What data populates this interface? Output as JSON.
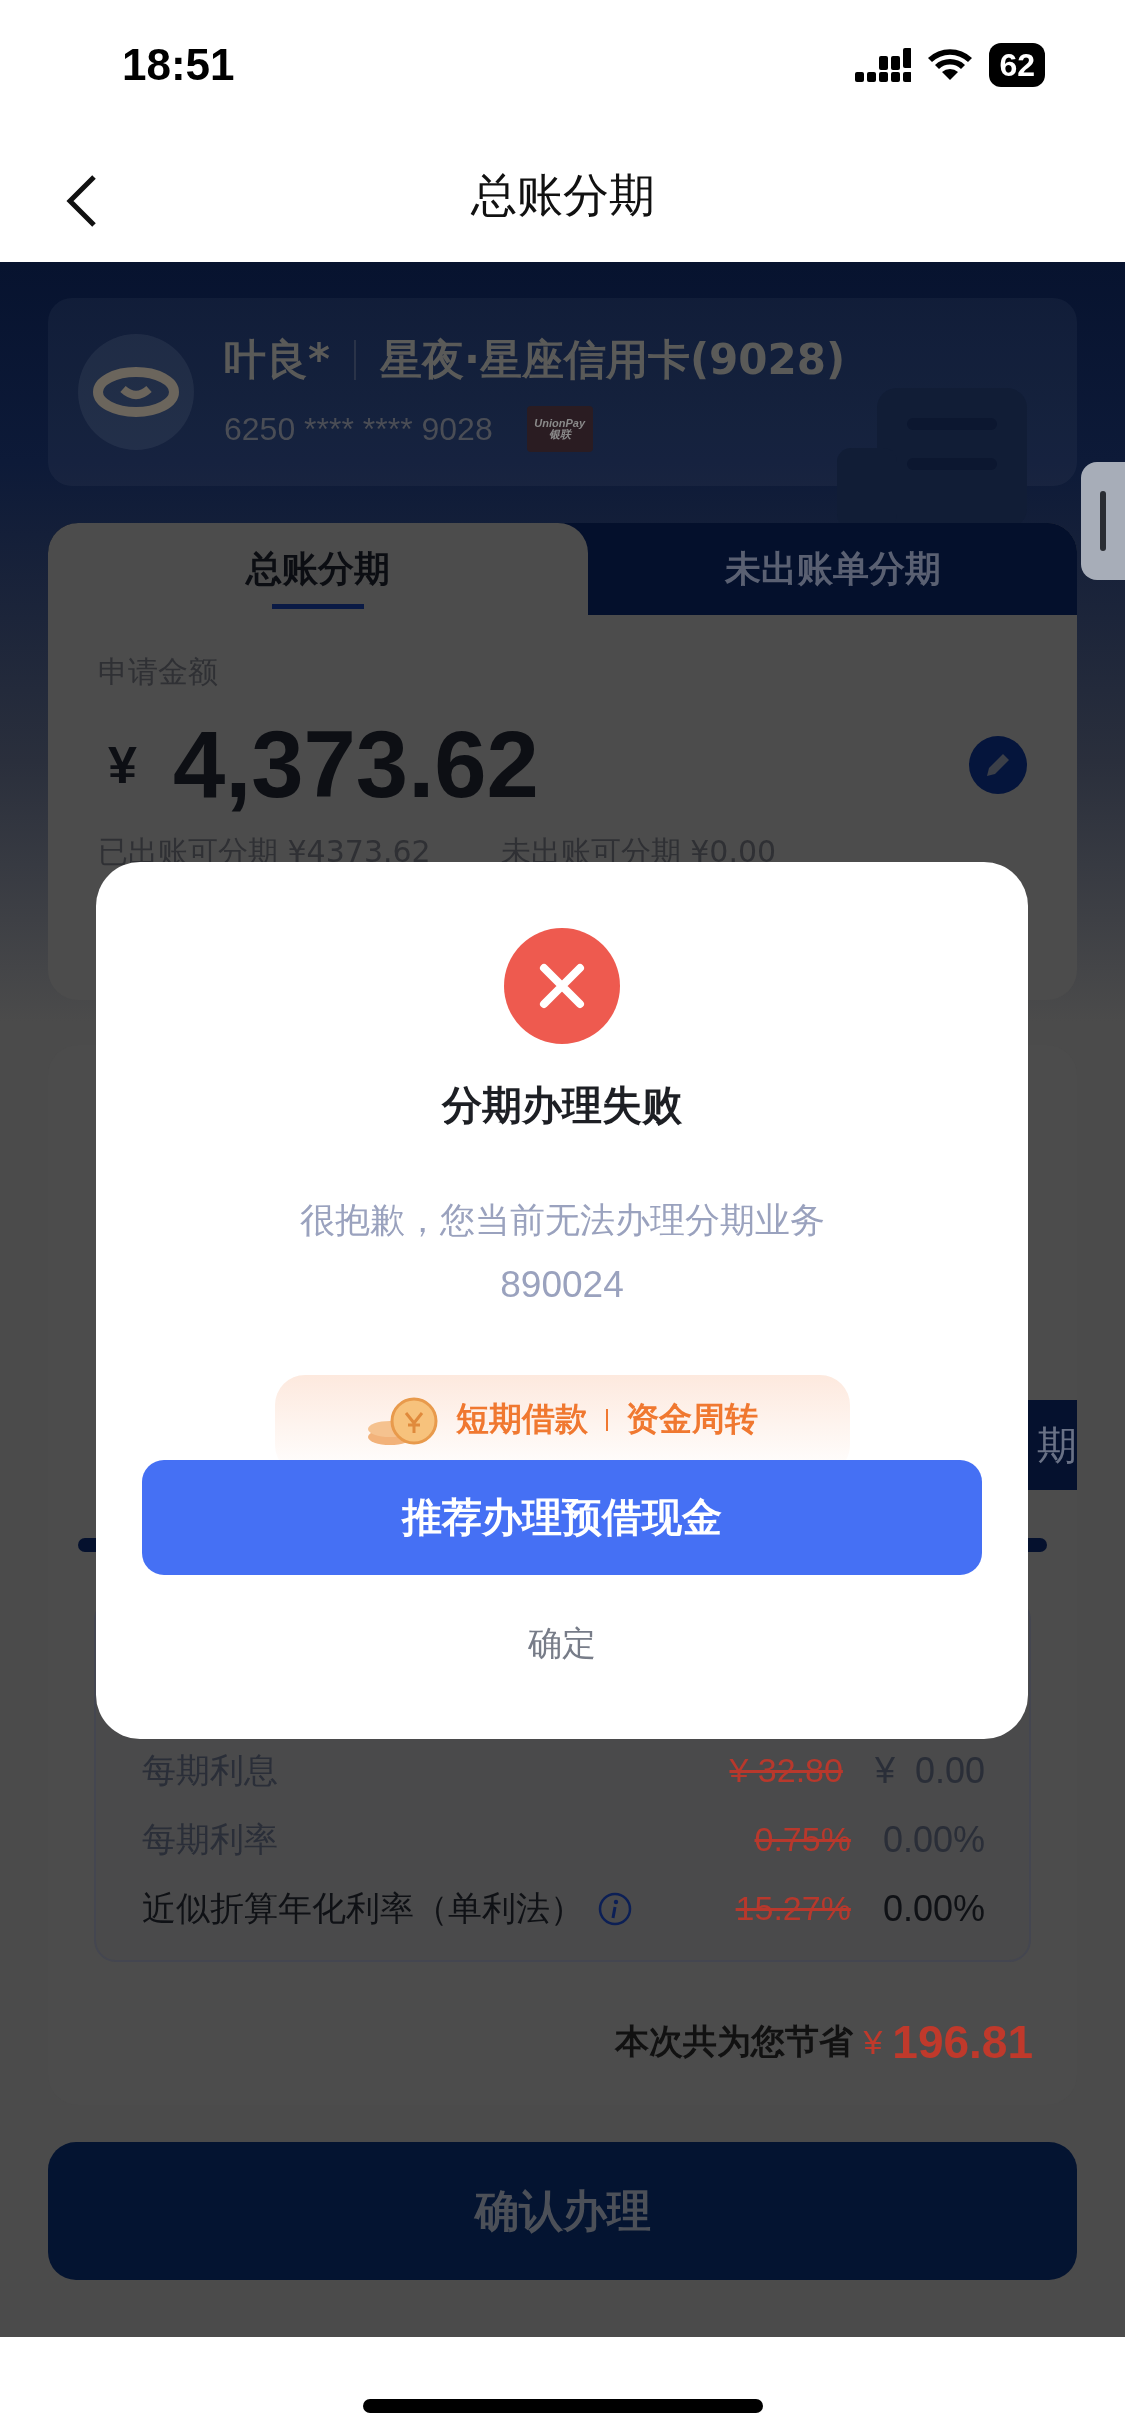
{
  "status_bar": {
    "time": "18:51",
    "battery": "62"
  },
  "nav": {
    "title": "总账分期"
  },
  "card": {
    "holder": "叶良*",
    "name": "星夜·星座信用卡(9028)",
    "number": "6250 **** **** 9028",
    "network_logo": [
      "UnionPay",
      "银联"
    ]
  },
  "tabs": [
    {
      "label": "总账分期",
      "selected": true
    },
    {
      "label": "未出账单分期",
      "selected": false
    }
  ],
  "amount": {
    "label": "申请金额",
    "currency": "¥",
    "value": "4,373.62",
    "billed": "已出账可分期 ¥4373.62",
    "unbilled": "未出账可分期 ¥0.00"
  },
  "term_tab": {
    "label": "期"
  },
  "fees": [
    {
      "label": "每期利息",
      "old": "¥ 32.80",
      "new": "¥  0.00",
      "kind": "muted"
    },
    {
      "label": "每期利率",
      "old": "0.75%",
      "new": "0.00%",
      "kind": "muted"
    },
    {
      "label": "近似折算年化利率（单利法）",
      "old": "15.27%",
      "new": "0.00%",
      "kind": "info"
    }
  ],
  "savings": {
    "label": "本次共为您节省",
    "currency": "¥",
    "value": "196.81"
  },
  "confirm_button": "确认办理",
  "dialog": {
    "title": "分期办理失败",
    "message": "很抱歉，您当前无法办理分期业务",
    "code": "890024",
    "promo": [
      "短期借款",
      "资金周转"
    ],
    "primary": "推荐办理预借现金",
    "secondary": "确定"
  }
}
